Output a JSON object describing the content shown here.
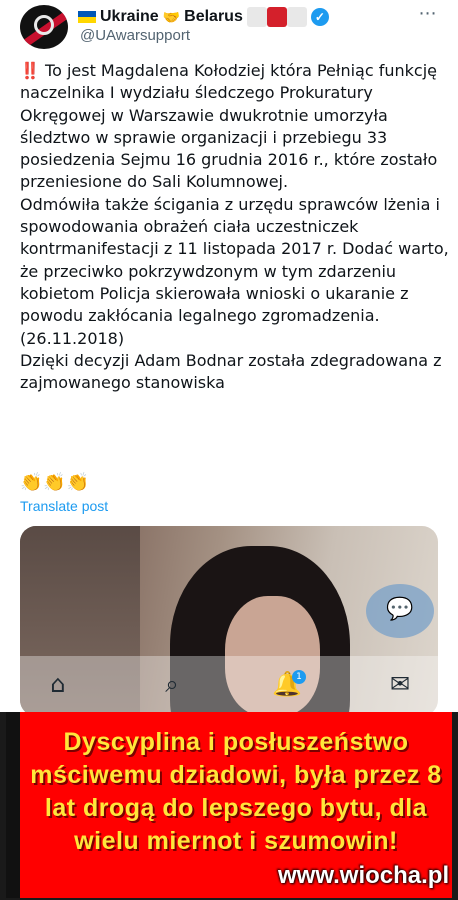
{
  "post": {
    "display_name": "Ukraine",
    "display_name_2": "Belarus",
    "handle": "@UAwarsupport",
    "more_icon": "⋯",
    "bang": "‼️",
    "text": "To jest Magdalena Kołodziej która Pełniąc funkcję naczelnika I wydziału śledczego Prokuratury Okręgowej w Warszawie dwukrotnie umorzyła śledztwo w sprawie organizacji i przebiegu 33 posiedzenia Sejmu 16 grudnia 2016 r., które zostało przeniesione do Sali Kolumnowej.\nOdmówiła także ścigania z urzędu sprawców lżenia i spowodowania obrażeń ciała uczestniczek kontrmanifestacji z 11 listopada 2017 r. Dodać warto, że przeciwko pokrzywdzonym w tym zdarzeniu kobietom Policja skierowała wnioski o ukaranie z powodu zakłócania legalnego zgromadzenia. (26.11.2018)\nDzięki decyzji Adam Bodnar została zdegradowana z zajmowanego stanowiska",
    "claps": "👏👏👏",
    "translate_label": "Translate post"
  },
  "nav": {
    "home_icon": "home-icon",
    "search_icon": "search-icon",
    "notifications_icon": "bell-icon",
    "notifications_badge": "1",
    "messages_icon": "mail-icon"
  },
  "banner": {
    "text": "Dyscyplina i posłuszeństwo mściwemu dziadowi, była przez 8 lat drogą do lepszego bytu, dla wielu miernot i szumowin!",
    "watermark": "www.wiocha.pl"
  },
  "colors": {
    "link": "#1d9bf0",
    "banner_bg": "#ff0000",
    "banner_text": "#ffe63b"
  }
}
